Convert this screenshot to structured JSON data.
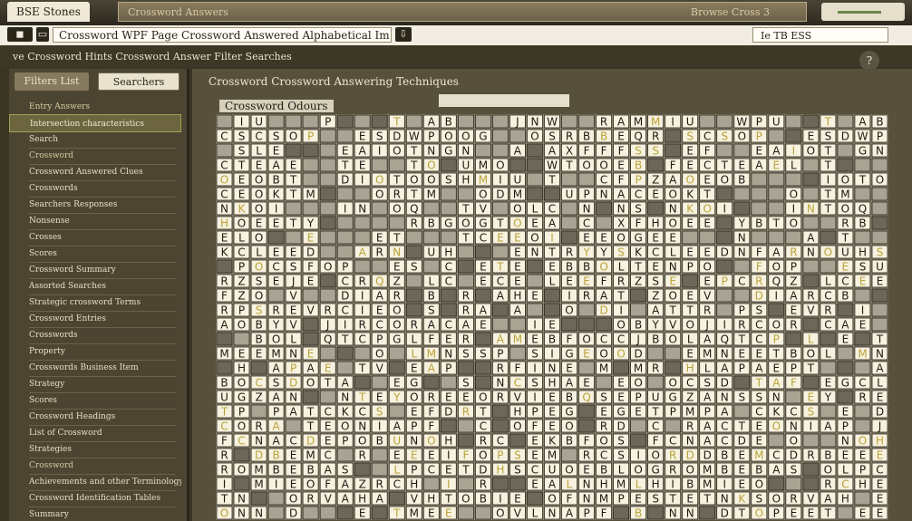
{
  "window": {
    "title": "BSE Stones",
    "tab_title": "Crossword Answers",
    "tab_right": "Browse Cross 3"
  },
  "addressbar": {
    "left_button": "◼",
    "url": "Crossword WPF Page Crossword Answered Alphabetical Im Seasonal Assessment",
    "right_button": "⇩",
    "right_field": "Ie  TB  ESS"
  },
  "header": {
    "breadcrumb": "ve  Crossword  Hints  Crossword  Answer  Filter  Searches"
  },
  "sidebar": {
    "button_left": "Filters List",
    "button_right": "Searchers",
    "items": [
      {
        "label": "Entry Answers",
        "type": "head"
      },
      {
        "label": "Intersection characteristics",
        "type": "hl"
      },
      {
        "label": "Search",
        "type": "normal"
      },
      {
        "label": "Crossword",
        "type": "head"
      },
      {
        "label": "Crossword Answered Clues",
        "type": "normal"
      },
      {
        "label": "Crosswords",
        "type": "normal"
      },
      {
        "label": "Searchers Responses",
        "type": "normal"
      },
      {
        "label": "Nonsense",
        "type": "normal"
      },
      {
        "label": "Crosses",
        "type": "normal"
      },
      {
        "label": "Scores",
        "type": "normal"
      },
      {
        "label": "Crossword Summary",
        "type": "normal"
      },
      {
        "label": "Assorted Searches",
        "type": "normal"
      },
      {
        "label": "Strategic crossword Terms",
        "type": "normal"
      },
      {
        "label": "Crossword Entries",
        "type": "normal"
      },
      {
        "label": "Crosswords",
        "type": "normal"
      },
      {
        "label": "Property",
        "type": "normal"
      },
      {
        "label": "Crosswords  Business Item",
        "type": "normal"
      },
      {
        "label": "Strategy",
        "type": "normal"
      },
      {
        "label": "Scores",
        "type": "normal"
      },
      {
        "label": "Crossword Headings",
        "type": "normal"
      },
      {
        "label": "List of Crossword",
        "type": "normal"
      },
      {
        "label": "Strategies",
        "type": "normal"
      },
      {
        "label": "Crossword",
        "type": "head"
      },
      {
        "label": "Achievements and other Terminology",
        "type": "normal"
      },
      {
        "label": "Crossword Identification Tables",
        "type": "normal"
      },
      {
        "label": "Summary",
        "type": "normal"
      }
    ]
  },
  "main": {
    "title": "Crossword Crossword Answering Techniques",
    "grid_title": "Crossword Odours",
    "grid": {
      "rows": [
        "MIU  WPU CT ABE  JNW  RAM",
        "CSCSOP  ESDWPOOG  OSRBBEQR",
        "SSLEF  EAIOTNGN  ASAXFFF",
        "CTEAEL TE  TOAUMOSFWTOOEBOFE",
        "OEOBT  DIOTOOSHMIU T  CFPZA",
        "CEOKTMT  ORTM  ODMCCUPNA",
        "NKOIF  INTOQ  TVDOLCENTNSF",
        "HOEETYBTO  RBGOGTOEAICEXF",
        "ELOVNE  AETL  TCEEOITEEOGE",
        "KCLEEDNFARNOUHSRFENTRYYS",
        "NPOCSFOP  ESUCFETEREBBOLTE",
        "RZSEJEPCRQZFLCEECEELEEF",
        "FZOEV  DIARCBTREAHEXIRAT",
        "RPSREVRCIEOCSFRANADTOODIAATTR",
        "AOBYVOJIRCORACAE  IEOF",
        "CJBOLAQTCPGLFERTAMEBFOC",
        "MEEMNEETBOLLMNSSPSSIGEOOD",
        "OHLAPAEPTVPEAPOURFINEIMIMR",
        "BOCSDOTAFIEGCLSUNCSHAEFEO",
        "UGZANSSNTEYOREEORVIEBQSEP",
        "TPMPATCKCSFEFDRTEHPEGSEGE",
        "CORACTEONIAPFJRCNOFEOJRDA",
        "FCNACDEPOBUNOHTRCKEKBFOSS",
        "RDDBEMCDRBEEEIFOPSEMQRCSIO",
        "ROMBEBASEOLPCETDHSCUOEBLOG",
        "IBMIEOFAZRCHEIDRFUEALNHMLH",
        "TNKSORVAHAEVHTOBIEHOFNMPESTE",
        "ONNIDTOPEETMEEMNOVLNAPFTB"
      ]
    }
  }
}
